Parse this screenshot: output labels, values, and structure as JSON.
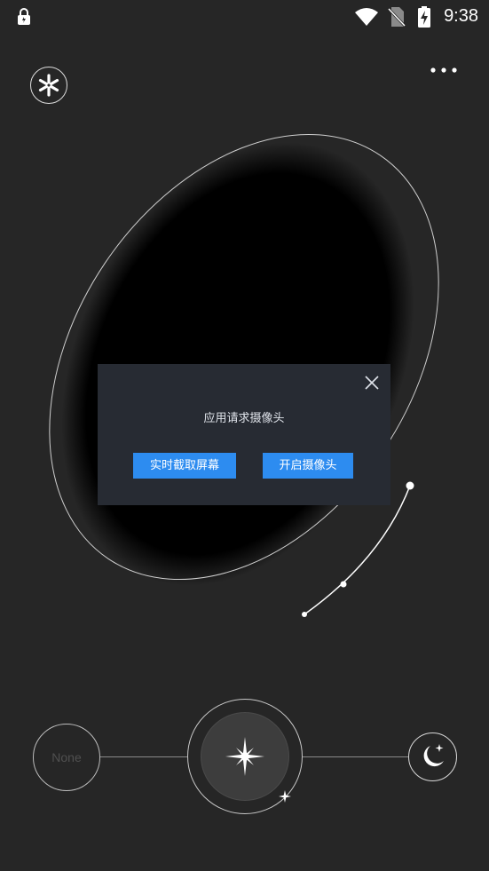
{
  "status_bar": {
    "time": "9:38",
    "icons": [
      "lock-icon",
      "wifi-icon",
      "no-sim-icon",
      "battery-charging-icon"
    ]
  },
  "header": {
    "logo_icon": "asterisk-logo-icon",
    "menu_icon": "more-dots-icon"
  },
  "dialog": {
    "message": "应用请求摄像头",
    "close_icon": "close-icon",
    "buttons": {
      "screen_capture": "实时截取屏幕",
      "open_camera": "开启摄像头"
    },
    "button_color": "#2d8cf0"
  },
  "controls": {
    "none_label": "None",
    "center_icon": "sparkle-star-icon",
    "small_icon": "small-star-icon",
    "night_icon": "moon-star-icon"
  },
  "colors": {
    "background": "#262626",
    "dialog_background": "#272b33"
  }
}
